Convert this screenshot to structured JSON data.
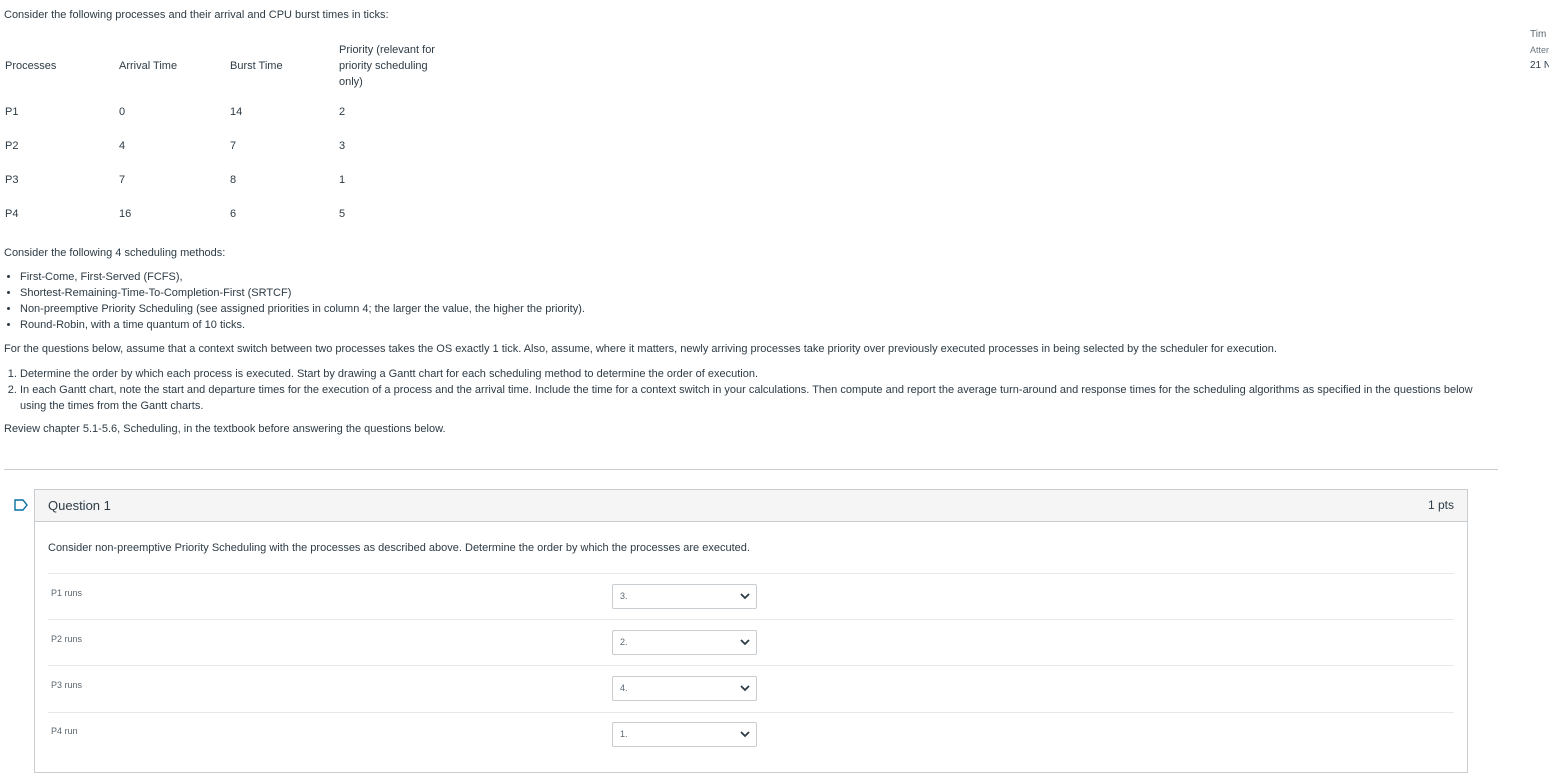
{
  "intro": "Consider the following processes and their arrival and CPU burst times in ticks:",
  "table": {
    "headers": [
      "Processes",
      "Arrival Time",
      "Burst Time",
      "Priority (relevant for priority scheduling only)"
    ],
    "rows": [
      [
        "P1",
        "0",
        "14",
        "2"
      ],
      [
        "P2",
        "4",
        "7",
        "3"
      ],
      [
        "P3",
        "7",
        "8",
        "1"
      ],
      [
        "P4",
        "16",
        "6",
        "5"
      ]
    ]
  },
  "methods_intro": "Consider the following 4 scheduling methods:",
  "methods": [
    "First-Come, First-Served (FCFS),",
    "Shortest-Remaining-Time-To-Completion-First (SRTCF)",
    "Non-preemptive Priority Scheduling (see assigned priorities in column 4; the larger the value, the higher the priority).",
    "Round-Robin, with a time quantum of 10 ticks."
  ],
  "assumption": "For the questions below, assume that a context switch between two processes takes the OS exactly 1 tick. Also, assume, where it matters, newly arriving processes take priority over previously executed processes in being selected by the scheduler for execution.",
  "steps": [
    "Determine the order by which each process is executed. Start by drawing a Gantt chart for each scheduling method to determine the order of execution.",
    "In each Gantt chart, note the start and departure times for the execution of a process and the arrival time. Include the time for a context switch in your calculations. Then compute and report the average turn-around and response times for the scheduling algorithms as specified in the questions below using the times from the Gantt charts."
  ],
  "review": "Review chapter 5.1-5.6, Scheduling, in the textbook before answering the questions below.",
  "question": {
    "title": "Question 1",
    "points": "1 pts",
    "text": "Consider non-preemptive Priority Scheduling with the processes as described above. Determine the order by which the processes are executed.",
    "answers": [
      {
        "label": "P1 runs",
        "selected": "3."
      },
      {
        "label": "P2 runs",
        "selected": "2."
      },
      {
        "label": "P3 runs",
        "selected": "4."
      },
      {
        "label": "P4 run",
        "selected": "1."
      }
    ]
  },
  "sidebar": {
    "line1": "Tim",
    "line2": "Atter",
    "line3": "21 N"
  }
}
